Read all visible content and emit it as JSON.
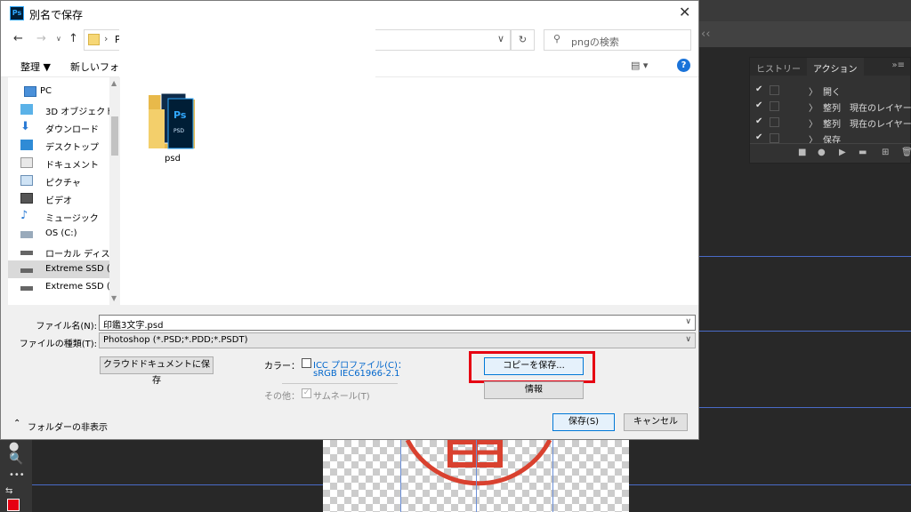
{
  "dialog": {
    "app_icon": "Ps",
    "title": "別名で保存",
    "close_glyph": "✕",
    "address_path": "P",
    "search_placeholder": "pngの検索",
    "toolbar": {
      "organize": "整理 ▼",
      "new_folder": "新しいフォル",
      "help": "?"
    },
    "nav_items": [
      {
        "label": "PC",
        "icon": "pc-icon"
      },
      {
        "label": "3D オブジェクト",
        "icon": "3d-objects-icon"
      },
      {
        "label": "ダウンロード",
        "icon": "download-icon"
      },
      {
        "label": "デスクトップ",
        "icon": "desktop-icon"
      },
      {
        "label": "ドキュメント",
        "icon": "document-icon"
      },
      {
        "label": "ピクチャ",
        "icon": "picture-icon"
      },
      {
        "label": "ビデオ",
        "icon": "video-icon"
      },
      {
        "label": "ミュージック",
        "icon": "music-icon"
      },
      {
        "label": "OS (C:)",
        "icon": "os-drive-icon"
      },
      {
        "label": "ローカル ディスク (D",
        "icon": "drive-icon"
      },
      {
        "label": "Extreme SSD (G:)",
        "icon": "drive-icon",
        "selected": true
      },
      {
        "label": "Extreme SSD (H:)",
        "icon": "drive-icon"
      }
    ],
    "folder": {
      "name": "psd",
      "badge": "Ps",
      "sub": "PSD"
    },
    "filename_label": "ファイル名(N):",
    "filename_value": "印鑑3文字.psd",
    "filetype_label": "ファイルの種類(T):",
    "filetype_value": "Photoshop (*.PSD;*.PDD;*.PSDT)",
    "cloud_button": "クラウドドキュメントに保存",
    "color_label": "カラー：",
    "icc_line1": "ICC プロファイル(C)：",
    "icc_line2": "sRGB IEC61966-2.1",
    "other_label": "その他：",
    "thumbnail_label": "サムネール(T)",
    "save_copy_button": "コピーを保存...",
    "info_button": "情報",
    "hide_folders": "フォルダーの非表示",
    "save_button": "保存(S)",
    "cancel_button": "キャンセル"
  },
  "panel": {
    "tabs": [
      "ヒストリー",
      "アクション"
    ],
    "menu": "»≡",
    "actions": [
      {
        "label": "開く"
      },
      {
        "label": "整列　現在のレイヤー"
      },
      {
        "label": "整列　現在のレイヤー"
      },
      {
        "label": "保存"
      }
    ]
  },
  "toolbar_glyph": "•••",
  "colors": {
    "accent": "#0078d7",
    "highlight": "#e60012",
    "seal": "#d9412f",
    "guide": "#4a6bc7"
  }
}
